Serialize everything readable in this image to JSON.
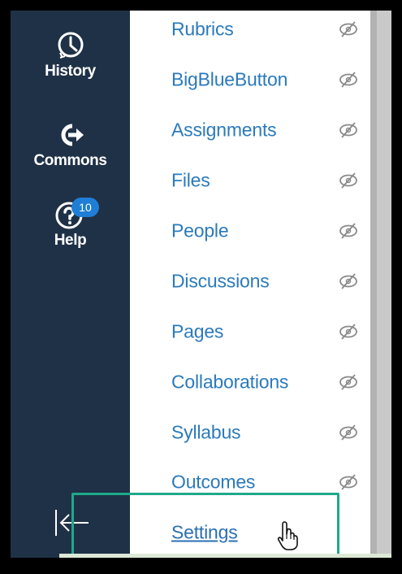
{
  "global_nav": {
    "items": [
      {
        "label": "History",
        "icon": "clock-icon"
      },
      {
        "label": "Commons",
        "icon": "commons-arrow-icon"
      },
      {
        "label": "Help",
        "icon": "help-question-icon",
        "badge": "10"
      }
    ],
    "collapse_icon": "collapse-left-arrow-icon"
  },
  "course_nav": {
    "items": [
      {
        "label": "Rubrics",
        "hidden_icon": "eye-slash-icon"
      },
      {
        "label": "BigBlueButton",
        "hidden_icon": "eye-slash-icon"
      },
      {
        "label": "Assignments",
        "hidden_icon": "eye-slash-icon"
      },
      {
        "label": "Files",
        "hidden_icon": "eye-slash-icon"
      },
      {
        "label": "People",
        "hidden_icon": "eye-slash-icon"
      },
      {
        "label": "Discussions",
        "hidden_icon": "eye-slash-icon"
      },
      {
        "label": "Pages",
        "hidden_icon": "eye-slash-icon"
      },
      {
        "label": "Collaborations",
        "hidden_icon": "eye-slash-icon"
      },
      {
        "label": "Syllabus",
        "hidden_icon": "eye-slash-icon"
      },
      {
        "label": "Outcomes",
        "hidden_icon": "eye-slash-icon"
      },
      {
        "label": "Settings",
        "state": "hover"
      }
    ]
  },
  "colors": {
    "nav_background": "#1f3147",
    "link": "#2b7abc",
    "badge": "#1f7ed6",
    "highlight_box": "#1fa98a"
  }
}
